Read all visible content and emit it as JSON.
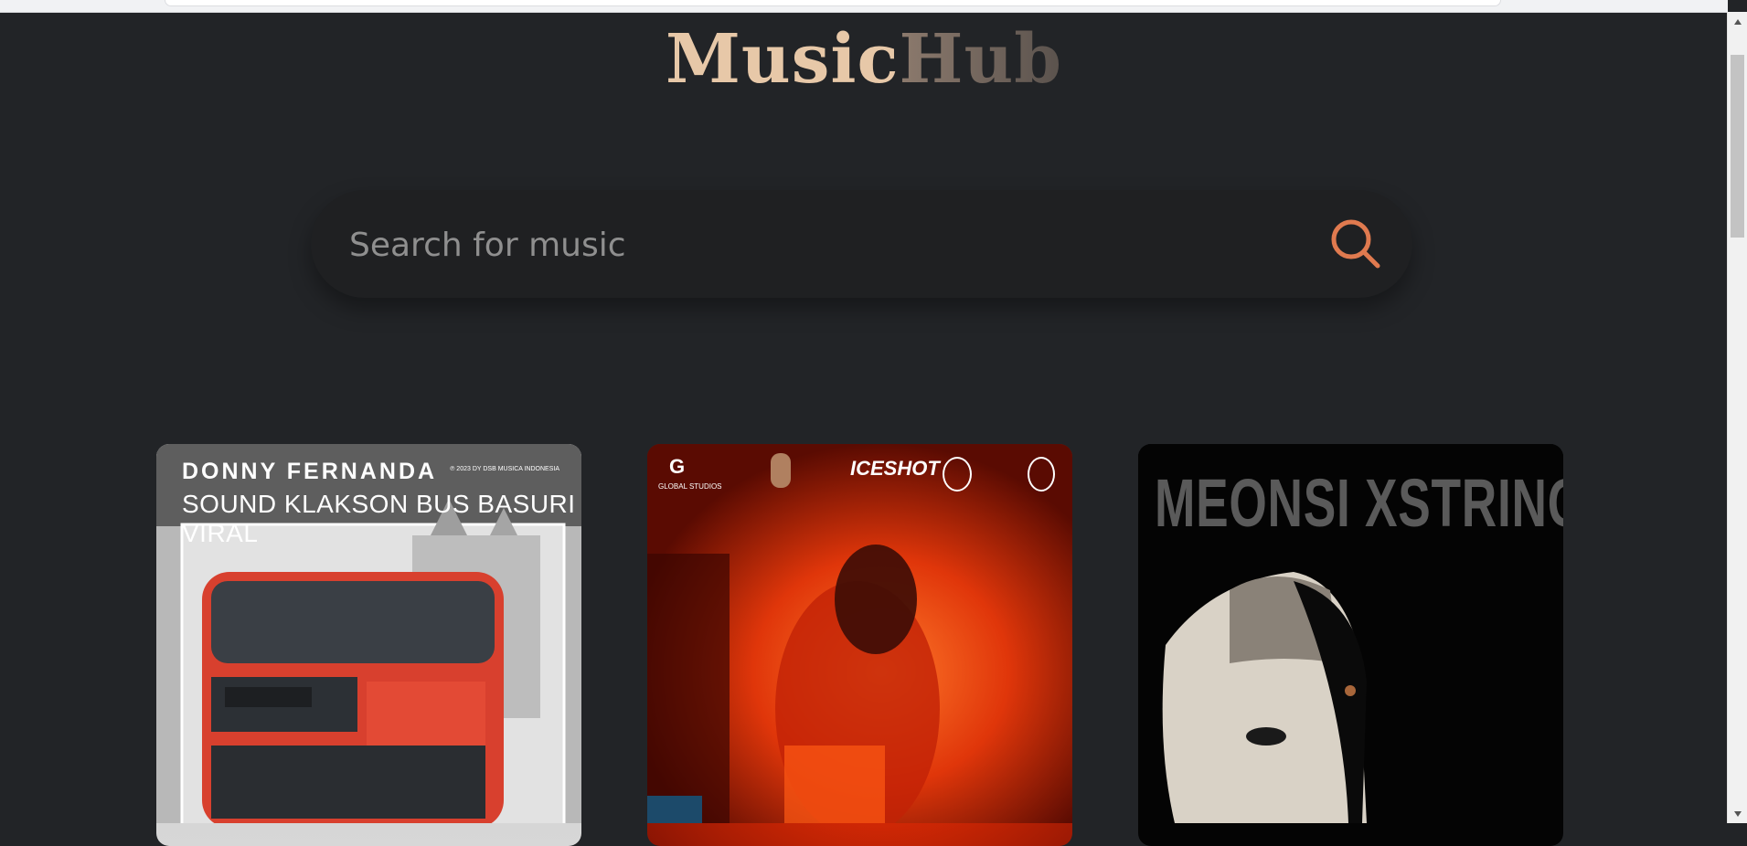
{
  "app": {
    "logo_part1": "Music",
    "logo_part2": "Hub"
  },
  "search": {
    "placeholder": "Search for music",
    "value": ""
  },
  "icons": {
    "search": "search-icon",
    "scroll_up": "chevron-up-icon",
    "scroll_down": "chevron-down-icon"
  },
  "colors": {
    "background": "#222427",
    "accent": "#e07a4f",
    "logo_primary": "#e7c8a8",
    "logo_secondary": "#6f655e"
  },
  "cards": [
    {
      "artist": "DONNY FERNANDA",
      "title": "SOUND KLAKSON BUS BASURI VIRAL",
      "small_text": "℗ 2023 DY DSB MUSICA INDONESIA"
    },
    {
      "logo_texts": [
        "G",
        "GLOBAL STUDIOS",
        "ICESHOT"
      ]
    },
    {
      "cover_text": "MEONSI XSTRING"
    }
  ]
}
